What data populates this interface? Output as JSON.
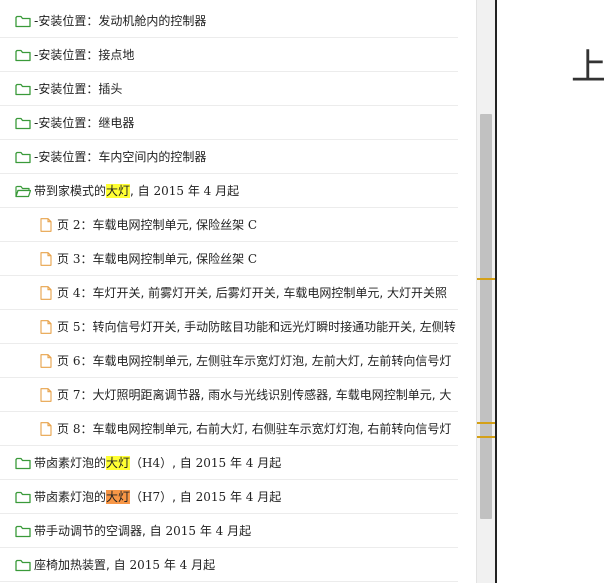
{
  "tree": {
    "rows": [
      {
        "level": 1,
        "icon": "folder-closed-icon",
        "parts": [
          {
            "t": "-安装位置：发动机舱内的控制器"
          }
        ]
      },
      {
        "level": 1,
        "icon": "folder-closed-icon",
        "parts": [
          {
            "t": "-安装位置：接点地"
          }
        ]
      },
      {
        "level": 1,
        "icon": "folder-closed-icon",
        "parts": [
          {
            "t": "-安装位置：插头"
          }
        ]
      },
      {
        "level": 1,
        "icon": "folder-closed-icon",
        "parts": [
          {
            "t": "-安装位置：继电器"
          }
        ]
      },
      {
        "level": 1,
        "icon": "folder-closed-icon",
        "parts": [
          {
            "t": "-安装位置：车内空间内的控制器"
          }
        ]
      },
      {
        "level": 1,
        "icon": "folder-open-icon",
        "parts": [
          {
            "t": "带到家模式的"
          },
          {
            "t": "大灯",
            "hl": "yellow"
          },
          {
            "t": ", 自 "
          },
          {
            "t": "2015",
            "serif": true
          },
          {
            "t": " 年 "
          },
          {
            "t": "4",
            "serif": true
          },
          {
            "t": " 月起"
          }
        ]
      },
      {
        "level": 2,
        "icon": "page-icon",
        "parts": [
          {
            "t": "页 "
          },
          {
            "t": "2",
            "serif": true
          },
          {
            "t": "：车载电网控制单元, 保险丝架 "
          },
          {
            "t": "C",
            "serif": true
          }
        ]
      },
      {
        "level": 2,
        "icon": "page-icon",
        "parts": [
          {
            "t": "页 "
          },
          {
            "t": "3",
            "serif": true
          },
          {
            "t": "：车载电网控制单元, 保险丝架 "
          },
          {
            "t": "C",
            "serif": true
          }
        ]
      },
      {
        "level": 2,
        "icon": "page-icon",
        "parts": [
          {
            "t": "页 "
          },
          {
            "t": "4",
            "serif": true
          },
          {
            "t": "：车灯开关, 前雾灯开关, 后雾灯开关, 车载电网控制单元, 大灯开关照"
          }
        ]
      },
      {
        "level": 2,
        "icon": "page-icon",
        "parts": [
          {
            "t": "页 "
          },
          {
            "t": "5",
            "serif": true
          },
          {
            "t": "：转向信号灯开关, 手动防眩目功能和远光灯瞬时接通功能开关, 左侧转"
          }
        ]
      },
      {
        "level": 2,
        "icon": "page-icon",
        "parts": [
          {
            "t": "页 "
          },
          {
            "t": "6",
            "serif": true
          },
          {
            "t": "：车载电网控制单元, 左侧驻车示宽灯灯泡, 左前大灯, 左前转向信号灯"
          }
        ]
      },
      {
        "level": 2,
        "icon": "page-icon",
        "parts": [
          {
            "t": "页 "
          },
          {
            "t": "7",
            "serif": true
          },
          {
            "t": "：大灯照明距离调节器, 雨水与光线识别传感器, 车载电网控制单元, 大"
          }
        ]
      },
      {
        "level": 2,
        "icon": "page-icon",
        "parts": [
          {
            "t": "页 "
          },
          {
            "t": "8",
            "serif": true
          },
          {
            "t": "：车载电网控制单元, 右前大灯, 右侧驻车示宽灯灯泡, 右前转向信号灯"
          }
        ]
      },
      {
        "level": 1,
        "icon": "folder-closed-icon",
        "parts": [
          {
            "t": "带卤素灯泡的"
          },
          {
            "t": "大灯",
            "hl": "yellow"
          },
          {
            "t": "（"
          },
          {
            "t": "H4",
            "serif": true
          },
          {
            "t": "）, 自 "
          },
          {
            "t": "2015",
            "serif": true
          },
          {
            "t": " 年 "
          },
          {
            "t": "4",
            "serif": true
          },
          {
            "t": " 月起"
          }
        ]
      },
      {
        "level": 1,
        "icon": "folder-closed-icon",
        "parts": [
          {
            "t": "带卤素灯泡的"
          },
          {
            "t": "大灯",
            "hl": "orange"
          },
          {
            "t": "（"
          },
          {
            "t": "H7",
            "serif": true
          },
          {
            "t": "）, 自 "
          },
          {
            "t": "2015",
            "serif": true
          },
          {
            "t": " 年 "
          },
          {
            "t": "4",
            "serif": true
          },
          {
            "t": " 月起"
          }
        ]
      },
      {
        "level": 1,
        "icon": "folder-closed-icon",
        "parts": [
          {
            "t": "带手动调节的空调器, 自 "
          },
          {
            "t": "2015",
            "serif": true
          },
          {
            "t": " 年 "
          },
          {
            "t": "4",
            "serif": true
          },
          {
            "t": " 月起"
          }
        ]
      },
      {
        "level": 1,
        "icon": "folder-closed-icon",
        "parts": [
          {
            "t": "座椅加热装置, 自 "
          },
          {
            "t": "2015",
            "serif": true
          },
          {
            "t": " 年 "
          },
          {
            "t": "4",
            "serif": true
          },
          {
            "t": " 月起"
          }
        ]
      }
    ]
  },
  "document": {
    "visible_glyph": "上"
  },
  "colors": {
    "folder_green": "#3a9a3a",
    "page_orange": "#e8a24a",
    "highlight_yellow": "#ffff33",
    "highlight_orange": "#f79646",
    "scroll_marker": "#d4a017"
  }
}
